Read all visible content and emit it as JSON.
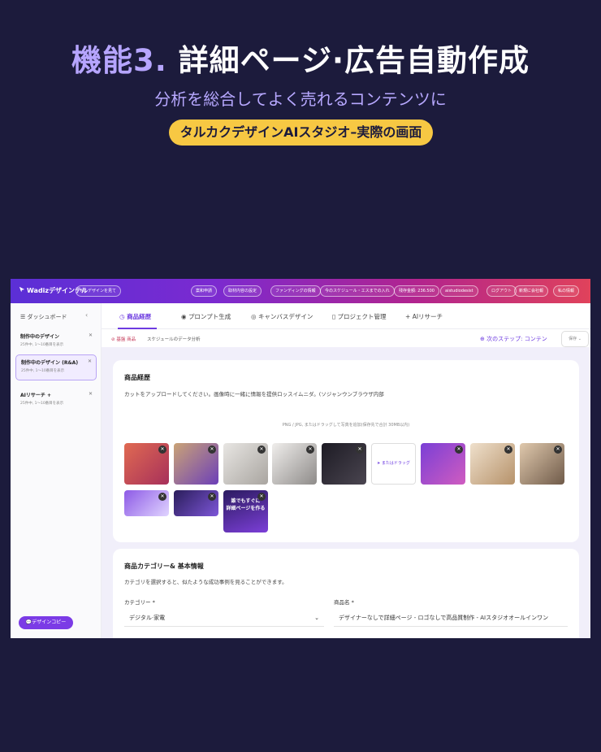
{
  "hero": {
    "title_accent": "機能3.",
    "title_main": "詳細ページ·広告自動作成",
    "subtitle": "分析を総合してよく売れるコンテンツに",
    "pill": "タルカクデザインAIスタジオ–実際の画面"
  },
  "topbar": {
    "brand": "Wadizデザインテル",
    "my_design": "MY デザインを見て",
    "buttons": [
      "案和申請",
      "取材内容の設定",
      "ファンディングの情報",
      "今のスケジュール・エスまでの入れ",
      "残存金額: 236.500",
      "aistudiodesist",
      "ログアウト",
      "新規に会社報",
      "私の情報"
    ]
  },
  "sidebar": {
    "dashboard": "ダッシュボード",
    "items": [
      {
        "title": "制作中のデザイン",
        "note": "25件中, 1〜10番目を表示"
      },
      {
        "title": "制作中のデザイン (R&A)",
        "note": "25件中, 1〜10番目を表示"
      },
      {
        "title": "AIリサーチ +",
        "note": "25件中, 1〜10番目を表示"
      }
    ],
    "bottom_button": "デザインコピー"
  },
  "tabs": [
    "商品経歴",
    "プロンプト生成",
    "キャンバスデザイン",
    "プロジェクト管理",
    "AIリサーチ"
  ],
  "subbar": {
    "left": "基盤 商品",
    "left2": "スケジュールのデータ分析",
    "next": "次のステップ: コンテン",
    "dropdown": "保存"
  },
  "product_card": {
    "title": "商品経歴",
    "desc": "カットをアップロードしてください。画像時に一緒に情報を提供ロッスイムニダ。(ソジャンウンブラウザ内部",
    "hint": "PNG / JPG, またはドラッグして写真を追加(保存先で合計 30MB以内)",
    "add_tile": "またはドラッグ"
  },
  "category_card": {
    "title": "商品カテゴリー& 基本情報",
    "desc": "カテゴリを選択すると、似たような成功事例を見ることができます。",
    "category_label": "カテゴリー *",
    "category_value": "デジタル·家電",
    "name_label": "商品名 *",
    "name_value": "デザイナーなしで詳細ページ - ロゴなしで高品質制作 - AIスタジオオールインワン"
  },
  "thumbnail_banner": {
    "line1": "誰でもすぐに",
    "line2": "詳細ページを作る"
  },
  "colors": {
    "background": "#1c1b3c",
    "accent": "#6d3be0",
    "pill": "#f7c843"
  }
}
